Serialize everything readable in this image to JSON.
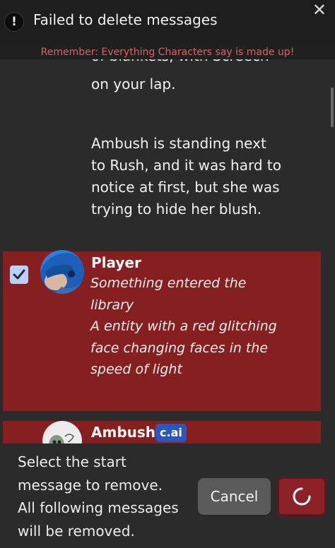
{
  "toast": {
    "message": "Failed to delete messages",
    "alert_glyph": "!",
    "close_glyph": "✕"
  },
  "disclaimer": "Remember: Everything Characters say is made up!",
  "chat": {
    "previous_bot_tail": {
      "cut_line": "of blankets, with Screech",
      "last_line": "on your lap."
    },
    "previous_bot_paragraph": [
      "Ambush is standing next",
      "to Rush, and it was hard to",
      "notice at first, but she was",
      "trying to hide her blush."
    ],
    "selected_message": {
      "author": "Player",
      "selected": true,
      "lines": [
        "Something entered the",
        "library",
        "A entity with a red glitching",
        "face changing faces in the",
        "speed of light"
      ]
    },
    "next_message": {
      "author": "Ambush",
      "badge": "c.ai"
    }
  },
  "bottom": {
    "instructions": [
      "Select the start",
      "message to remove.",
      "All following messages",
      "will be removed."
    ],
    "cancel_label": "Cancel"
  },
  "colors": {
    "selected_bg": "#861f1f",
    "confirm_bg": "#8c2228",
    "badge_bg": "#2c57b8",
    "checkbox_bg": "#bcd0ff",
    "disclaimer_text": "#e06060"
  }
}
